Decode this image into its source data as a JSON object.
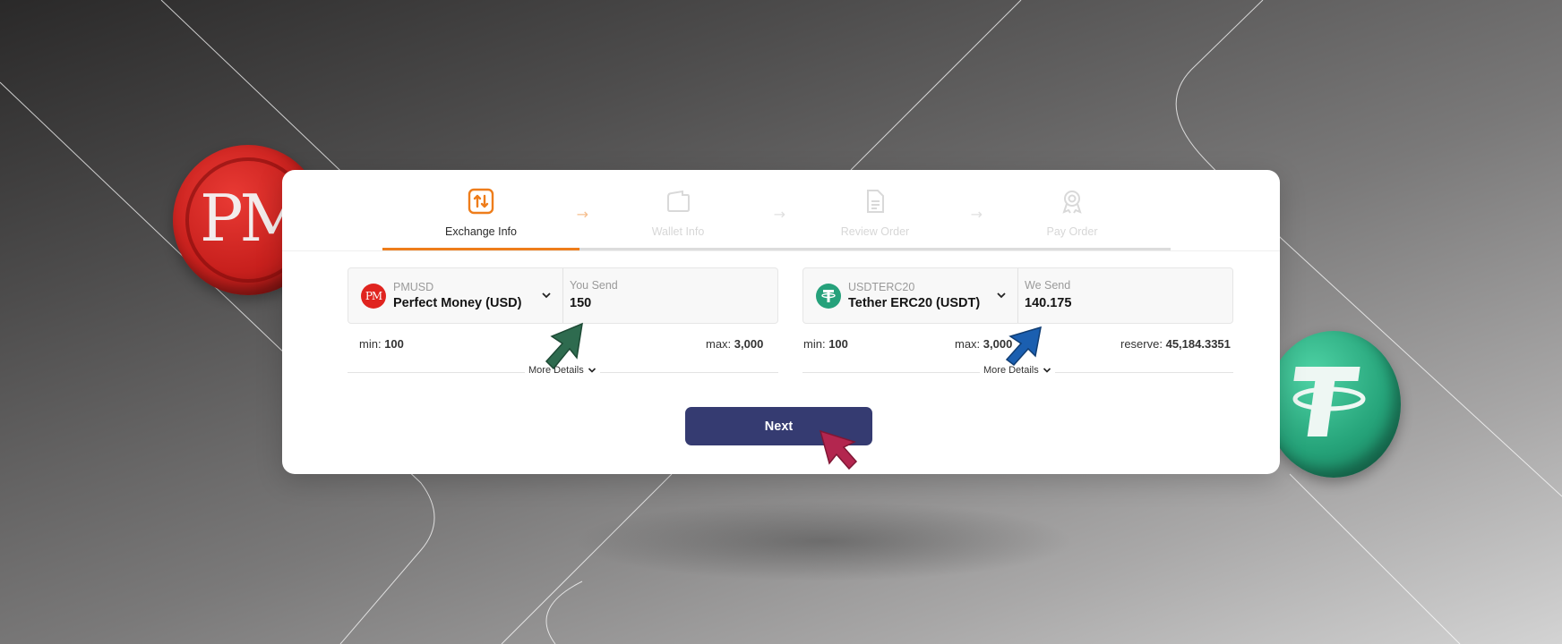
{
  "coins": {
    "left_logo_text": "PM",
    "right_logo_text": "T"
  },
  "steps": [
    {
      "label": "Exchange Info",
      "icon": "exchange-arrows-icon",
      "active": true
    },
    {
      "label": "Wallet Info",
      "icon": "wallet-icon",
      "active": false
    },
    {
      "label": "Review Order",
      "icon": "document-icon",
      "active": false
    },
    {
      "label": "Pay Order",
      "icon": "award-icon",
      "active": false
    }
  ],
  "send": {
    "currency_code": "PMUSD",
    "currency_name": "Perfect Money (USD)",
    "logo_text": "PM",
    "amount_label": "You Send",
    "amount_value": "150",
    "min_label": "min:",
    "min_value": "100",
    "max_label": "max:",
    "max_value": "3,000",
    "more_details": "More Details"
  },
  "receive": {
    "currency_code": "USDTERC20",
    "currency_name": "Tether ERC20 (USDT)",
    "logo_text": "T",
    "amount_label": "We Send",
    "amount_value": "140.175",
    "min_label": "min:",
    "min_value": "100",
    "max_label": "max:",
    "max_value": "3,000",
    "reserve_label": "reserve:",
    "reserve_value": "45,184.3351",
    "more_details": "More Details"
  },
  "next_label": "Next",
  "colors": {
    "accent": "#ee7d1b",
    "button": "#353b71",
    "pm_red": "#e0241f",
    "tether_green": "#26a17b",
    "cursor_green": "#2e6b4f",
    "cursor_blue": "#1b5fb0",
    "cursor_red": "#b3264f"
  }
}
